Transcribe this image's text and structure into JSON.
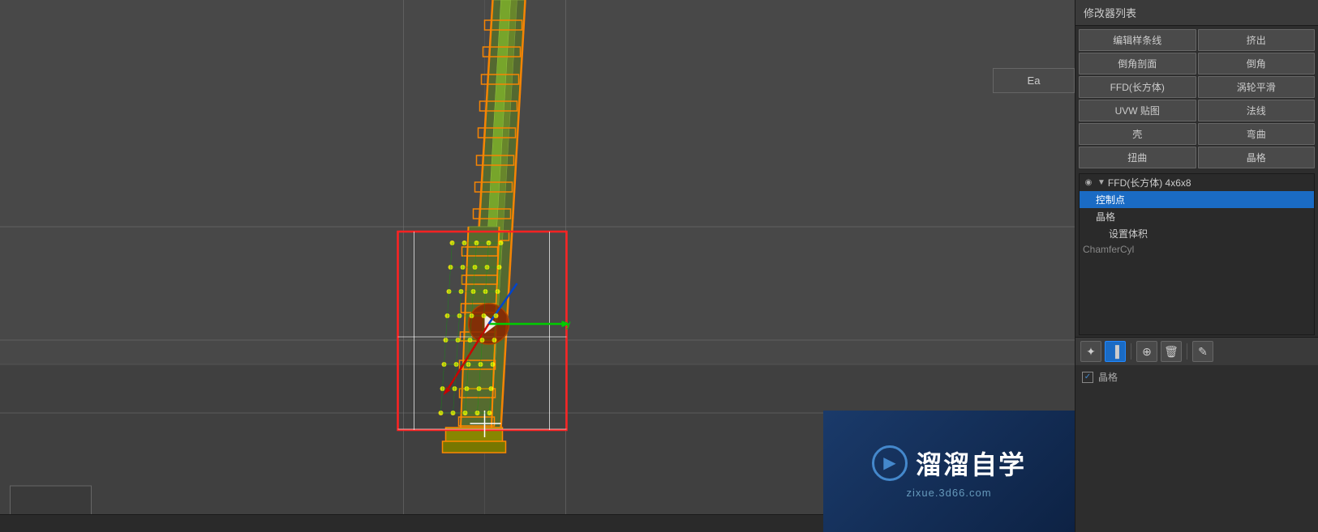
{
  "header": {
    "ea_button_label": "Ea"
  },
  "right_panel": {
    "modifier_list_title": "修改器列表",
    "buttons": [
      {
        "label": "编辑样条线",
        "col": 0
      },
      {
        "label": "挤出",
        "col": 1
      },
      {
        "label": "倒角剖面",
        "col": 0
      },
      {
        "label": "倒角",
        "col": 1
      },
      {
        "label": "FFD(长方体)",
        "col": 0
      },
      {
        "label": "涡轮平滑",
        "col": 1
      },
      {
        "label": "UVW 贴图",
        "col": 0
      },
      {
        "label": "法线",
        "col": 1
      },
      {
        "label": "壳",
        "col": 0
      },
      {
        "label": "弯曲",
        "col": 1
      },
      {
        "label": "扭曲",
        "col": 0
      },
      {
        "label": "晶格",
        "col": 1
      }
    ],
    "stack": {
      "items": [
        {
          "label": "FFD(长方体) 4x6x8",
          "indent": 0,
          "has_eye": true,
          "has_arrow": true,
          "active": false,
          "eye_char": "◉"
        },
        {
          "label": "控制点",
          "indent": 1,
          "has_eye": false,
          "has_arrow": false,
          "active": true
        },
        {
          "label": "晶格",
          "indent": 1,
          "has_eye": false,
          "has_arrow": false,
          "active": false
        },
        {
          "label": "设置体积",
          "indent": 2,
          "has_eye": false,
          "has_arrow": false,
          "active": false
        },
        {
          "label": "ChamferCyl",
          "indent": 0,
          "has_eye": false,
          "has_arrow": false,
          "active": false,
          "is_chamfer": true
        }
      ]
    },
    "toolbar": {
      "tools": [
        {
          "icon": "✦",
          "label": "pin-icon",
          "active": false
        },
        {
          "icon": "▐",
          "label": "modifier-icon",
          "active": true
        },
        {
          "icon": "⊕",
          "label": "add-icon",
          "active": false
        },
        {
          "icon": "🗑",
          "label": "delete-icon",
          "active": false
        },
        {
          "icon": "✎",
          "label": "edit-icon",
          "active": false
        }
      ]
    },
    "bottom_check": {
      "label": "晶格",
      "checked": true
    }
  },
  "watermark": {
    "icon_char": "▶",
    "text_cn": "溜溜自学",
    "url": "zixue.3d66.com"
  },
  "status": {
    "text": ""
  }
}
